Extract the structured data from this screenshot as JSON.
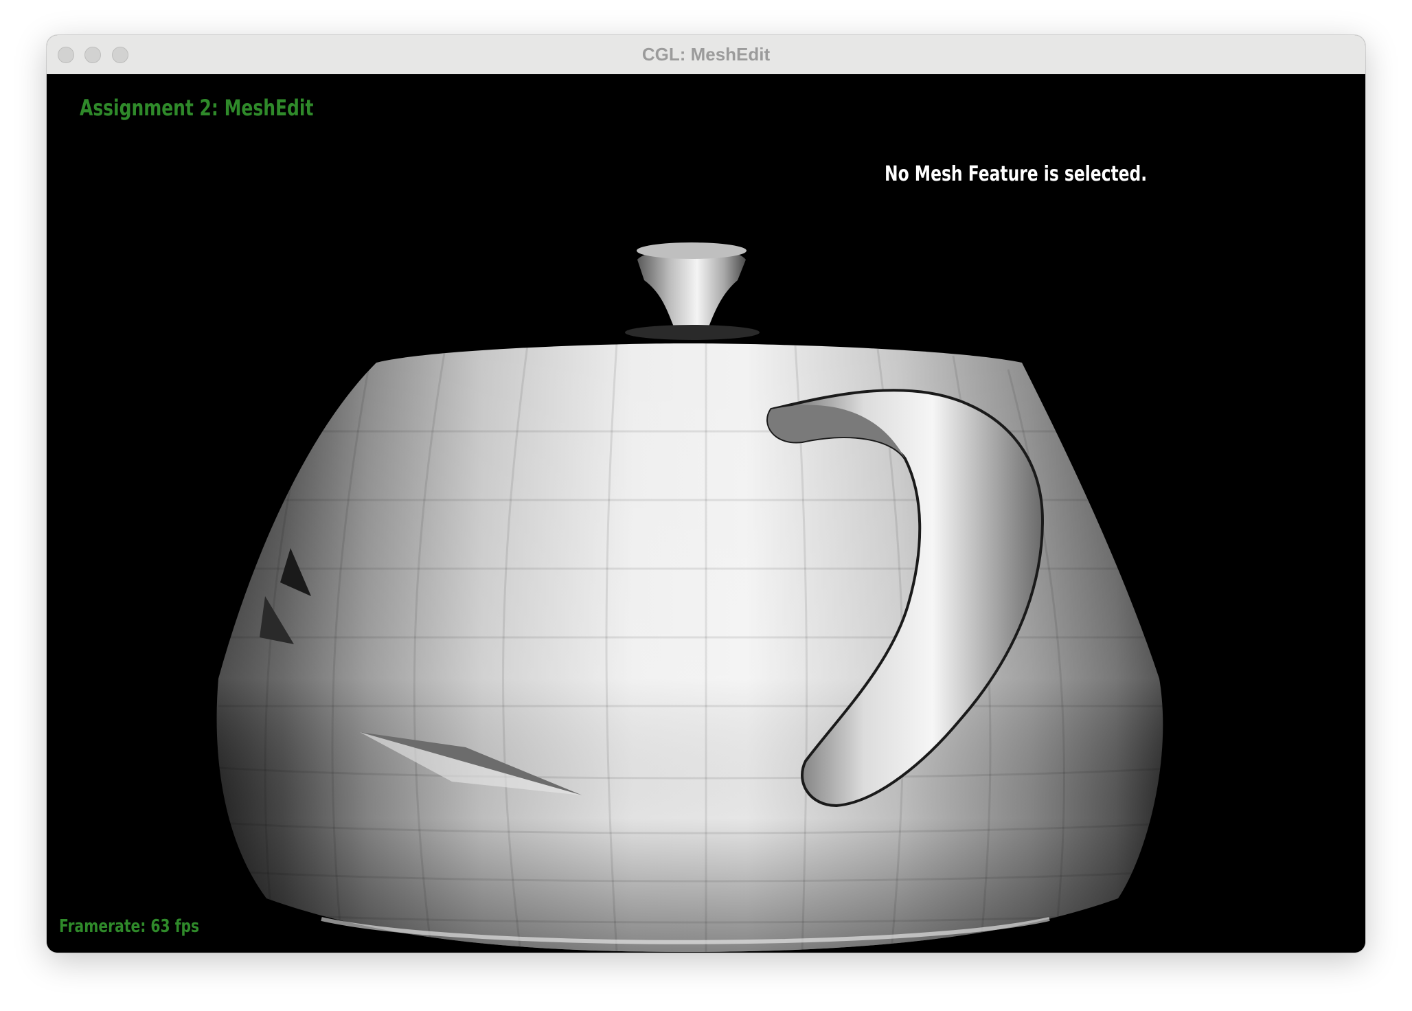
{
  "window": {
    "title": "CGL: MeshEdit",
    "buttons": [
      "close",
      "minimize",
      "zoom"
    ]
  },
  "viewport": {
    "background": "#000000",
    "heading": "Assignment 2: MeshEdit",
    "status": "No Mesh Feature is selected.",
    "framerate": "Framerate: 63 fps",
    "accent_color": "#2f8a2a",
    "model": "teapot"
  }
}
